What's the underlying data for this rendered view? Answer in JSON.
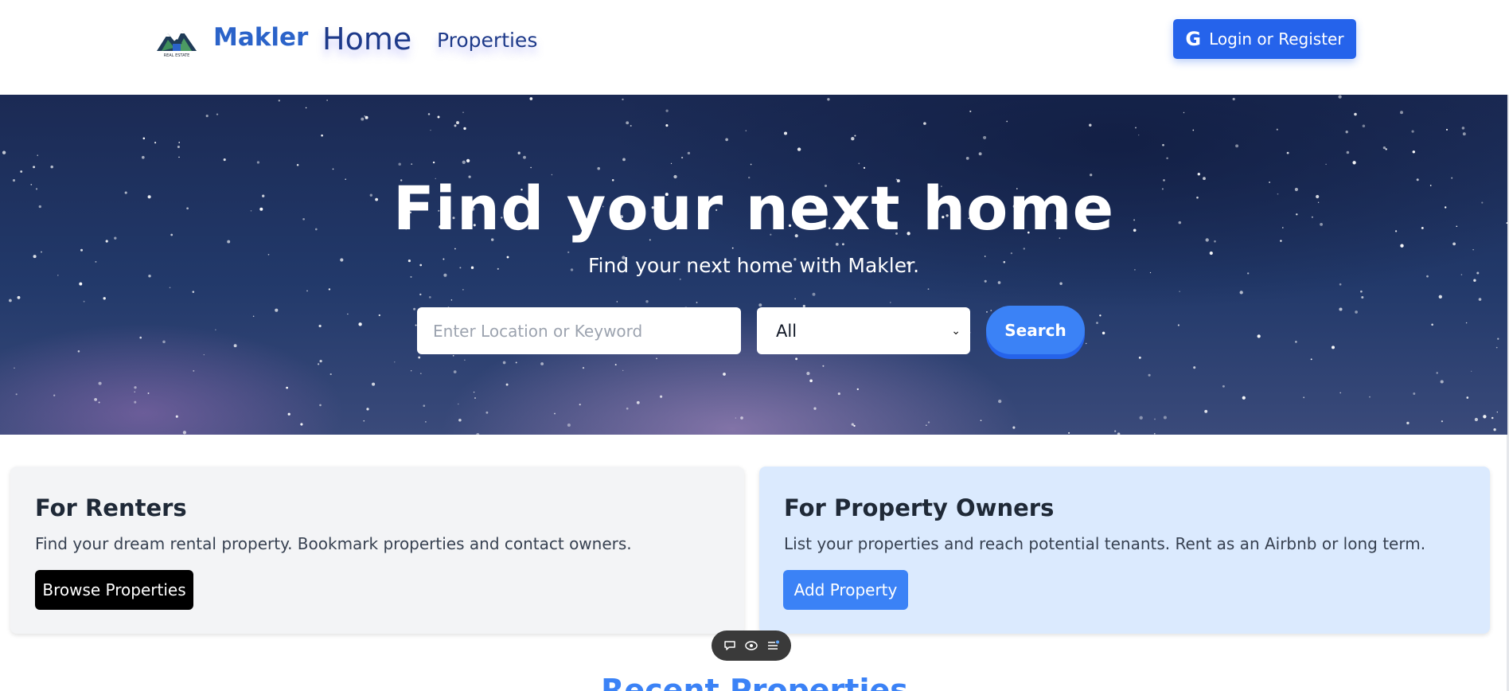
{
  "nav": {
    "brand": "Makler",
    "logo_icon": "mountain-house-logo",
    "links": [
      {
        "label": "Home"
      },
      {
        "label": "Properties"
      }
    ],
    "login_label": "Login or Register",
    "login_icon": "google-icon"
  },
  "hero": {
    "title": "Find your next home",
    "subtitle": "Find your next home with Makler.",
    "search_placeholder": "Enter Location or Keyword",
    "search_value": "",
    "type_selected": "All",
    "search_button": "Search"
  },
  "cards": {
    "renters": {
      "title": "For Renters",
      "text": "Find your dream rental property. Bookmark properties and contact owners.",
      "button": "Browse Properties"
    },
    "owners": {
      "title": "For Property Owners",
      "text": "List your properties and reach potential tenants. Rent as an Airbnb or long term.",
      "button": "Add Property"
    }
  },
  "toolbar": {
    "icons": [
      "comment-icon",
      "eye-icon",
      "menu-list-icon"
    ]
  },
  "recent": {
    "title": "Recent Properties"
  },
  "colors": {
    "primary": "#2563eb",
    "accent": "#3b82f6",
    "brand_text": "#2b63c9",
    "owners_bg": "#dbeafe",
    "renters_bg": "#f3f4f6"
  }
}
